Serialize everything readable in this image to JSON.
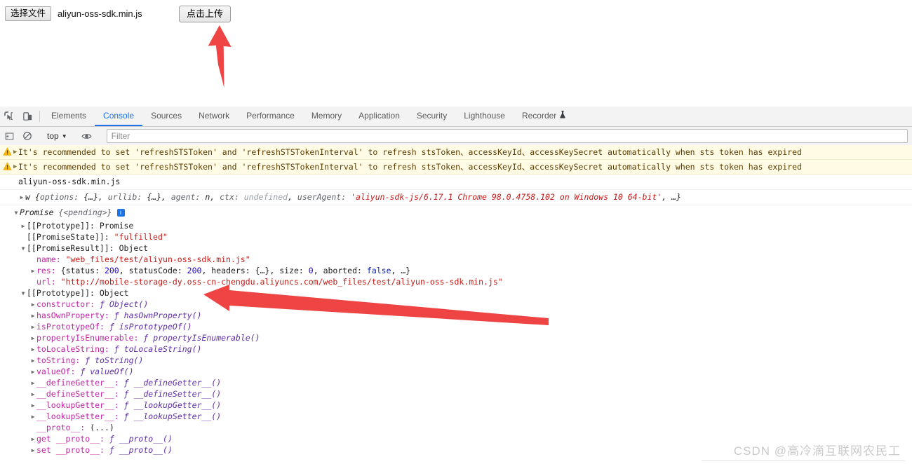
{
  "page": {
    "file_input": {
      "button_label": "选择文件",
      "file_name": "aliyun-oss-sdk.min.js"
    },
    "upload_button_label": "点击上传"
  },
  "devtools": {
    "tabs": [
      {
        "label": "Elements",
        "active": false
      },
      {
        "label": "Console",
        "active": true
      },
      {
        "label": "Sources",
        "active": false
      },
      {
        "label": "Network",
        "active": false
      },
      {
        "label": "Performance",
        "active": false
      },
      {
        "label": "Memory",
        "active": false
      },
      {
        "label": "Application",
        "active": false
      },
      {
        "label": "Security",
        "active": false
      },
      {
        "label": "Lighthouse",
        "active": false
      },
      {
        "label": "Recorder",
        "active": false,
        "badge": "experiment-flask-icon"
      }
    ],
    "toolbar": {
      "inspect_icon": "inspect-element-icon",
      "device_icon": "device-toolbar-icon",
      "sidebar_icon": "console-sidebar-icon",
      "clear_icon": "clear-console-icon",
      "context_value": "top",
      "eye_icon": "live-expression-eye-icon",
      "filter_placeholder": "Filter"
    }
  },
  "console": {
    "warnings": [
      "It's recommended to set 'refreshSTSToken' and 'refreshSTSTokenInterval' to refresh stsToken、accessKeyId、accessKeySecret automatically when sts token has expired",
      "It's recommended to set 'refreshSTSToken' and 'refreshSTSTokenInterval' to refresh stsToken、accessKeyId、accessKeySecret automatically when sts token has expired"
    ],
    "source_label": "aliyun-oss-sdk.min.js",
    "object_line": {
      "class_name": "w",
      "options_key": "options:",
      "options_val": "{…}",
      "urllib_key": "urllib:",
      "urllib_val": "{…}",
      "agent_key": "agent:",
      "agent_val": "n",
      "ctx_key": "ctx:",
      "ctx_val": "undefined",
      "user_agent_key": "userAgent:",
      "user_agent_val": "'aliyun-sdk-js/6.17.1 Chrome 98.0.4758.102 on Windows 10 64-bit'",
      "ellipsis": ", …}"
    },
    "promise": {
      "header_name": "Promise",
      "header_state": "{<pending>}",
      "info_badge": "i",
      "rows": [
        {
          "indent": 1,
          "disc": "closed",
          "key": "[[Prototype]]:",
          "key_style": "dark",
          "value": "Promise",
          "value_style": "dark"
        },
        {
          "indent": 1,
          "disc": "none",
          "key": "[[PromiseState]]:",
          "key_style": "dark",
          "value": "\"fulfilled\"",
          "value_style": "string"
        },
        {
          "indent": 1,
          "disc": "open",
          "key": "[[PromiseResult]]:",
          "key_style": "dark",
          "value": "Object",
          "value_style": "dark"
        },
        {
          "indent": 2,
          "disc": "none",
          "key": "name:",
          "key_style": "prop",
          "value": "\"web_files/test/aliyun-oss-sdk.min.js\"",
          "value_style": "string"
        },
        {
          "indent": 2,
          "disc": "closed",
          "key": "res:",
          "key_style": "prop",
          "value": "{status: 200, statusCode: 200, headers: {…}, size: 0, aborted: false, …}",
          "value_style": "mixed-res"
        },
        {
          "indent": 2,
          "disc": "none",
          "key": "url:",
          "key_style": "prop",
          "value": "\"http://mobile-storage-dy.oss-cn-chengdu.aliyuncs.com/web_files/test/aliyun-oss-sdk.min.js\"",
          "value_style": "string"
        },
        {
          "indent": 1,
          "disc": "open",
          "key": "[[Prototype]]:",
          "key_style": "dark",
          "value": "Object",
          "value_style": "dark"
        },
        {
          "indent": 2,
          "disc": "closed",
          "key": "constructor:",
          "key_style": "prop",
          "value": "ƒ Object()",
          "value_style": "fn"
        },
        {
          "indent": 2,
          "disc": "closed",
          "key": "hasOwnProperty:",
          "key_style": "prop",
          "value": "ƒ hasOwnProperty()",
          "value_style": "fn"
        },
        {
          "indent": 2,
          "disc": "closed",
          "key": "isPrototypeOf:",
          "key_style": "prop",
          "value": "ƒ isPrototypeOf()",
          "value_style": "fn"
        },
        {
          "indent": 2,
          "disc": "closed",
          "key": "propertyIsEnumerable:",
          "key_style": "prop",
          "value": "ƒ propertyIsEnumerable()",
          "value_style": "fn"
        },
        {
          "indent": 2,
          "disc": "closed",
          "key": "toLocaleString:",
          "key_style": "prop",
          "value": "ƒ toLocaleString()",
          "value_style": "fn"
        },
        {
          "indent": 2,
          "disc": "closed",
          "key": "toString:",
          "key_style": "prop",
          "value": "ƒ toString()",
          "value_style": "fn"
        },
        {
          "indent": 2,
          "disc": "closed",
          "key": "valueOf:",
          "key_style": "prop",
          "value": "ƒ valueOf()",
          "value_style": "fn"
        },
        {
          "indent": 2,
          "disc": "closed",
          "key": "__defineGetter__:",
          "key_style": "prop",
          "value": "ƒ __defineGetter__()",
          "value_style": "fn"
        },
        {
          "indent": 2,
          "disc": "closed",
          "key": "__defineSetter__:",
          "key_style": "prop",
          "value": "ƒ __defineSetter__()",
          "value_style": "fn"
        },
        {
          "indent": 2,
          "disc": "closed",
          "key": "__lookupGetter__:",
          "key_style": "prop",
          "value": "ƒ __lookupGetter__()",
          "value_style": "fn"
        },
        {
          "indent": 2,
          "disc": "closed",
          "key": "__lookupSetter__:",
          "key_style": "prop",
          "value": "ƒ __lookupSetter__()",
          "value_style": "fn"
        },
        {
          "indent": 2,
          "disc": "none",
          "key": "__proto__:",
          "key_style": "prop",
          "value": "(...)",
          "value_style": "dark"
        },
        {
          "indent": 2,
          "disc": "closed",
          "key": "get __proto__:",
          "key_style": "prop",
          "value": "ƒ __proto__()",
          "value_style": "fn"
        },
        {
          "indent": 2,
          "disc": "closed",
          "key": "set __proto__:",
          "key_style": "prop",
          "value": "ƒ __proto__()",
          "value_style": "fn"
        }
      ]
    }
  },
  "annotations": {
    "arrow_color": "#ef4444",
    "arrow_up_name": "red-arrow-up",
    "arrow_left_name": "red-arrow-left"
  },
  "watermark": {
    "text": "CSDN @高冷滴互联网农民工"
  }
}
